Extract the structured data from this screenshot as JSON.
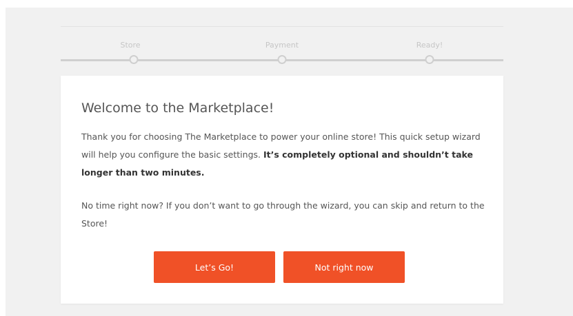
{
  "steps": {
    "items": [
      {
        "label": "Store"
      },
      {
        "label": "Payment"
      },
      {
        "label": "Ready!"
      }
    ]
  },
  "card": {
    "title": "Welcome to the Marketplace!",
    "intro_text": "Thank you for choosing The Marketplace to power your online store! This quick setup wizard will help you configure the basic settings. ",
    "intro_bold": "It’s completely optional and shouldn’t take longer than two minutes.",
    "skip_text": "No time right now? If you don’t want to go through the wizard, you can skip and return to the Store!"
  },
  "buttons": {
    "go_label": "Let’s Go!",
    "skip_label": "Not right now"
  },
  "colors": {
    "accent": "#f05127",
    "background": "#f1f1f1",
    "track": "#cfcfcf"
  }
}
